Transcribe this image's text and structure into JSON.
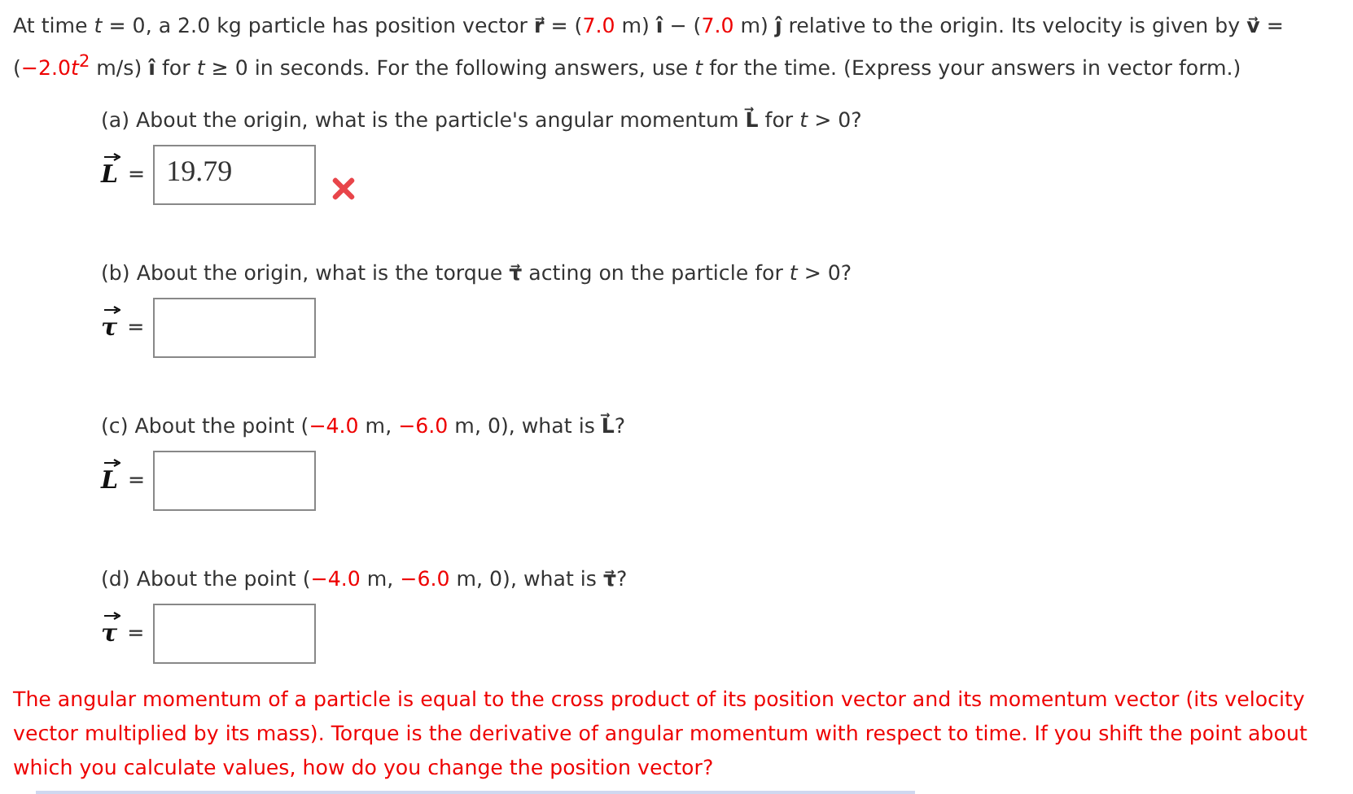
{
  "intro": [
    {
      "text": "At time *t* = 0, a 2.0 kg particle has position vector **r⃗** = (",
      "red": false
    },
    {
      "text": "7.0",
      "red": true
    },
    {
      "text": " m) **î** − (",
      "red": false
    },
    {
      "text": "7.0",
      "red": true
    },
    {
      "text": " m) **ĵ** relative to the origin. Its velocity is given by **v⃗** = (",
      "red": false
    },
    {
      "text": "−2.0",
      "red": true
    },
    {
      "text": "*t*$^{2}$",
      "red": true
    },
    {
      "text": " m/s) **î** for *t* ≥ 0 in seconds. For the following answers, use *t* for the time. (Express your answers in vector form.)",
      "red": false
    }
  ],
  "questions": [
    {
      "prompt": [
        {
          "text": "(a) About the origin, what is the particle's angular momentum **L⃗** for *t* > 0?",
          "red": false
        }
      ],
      "symbol": "L",
      "relation": "=",
      "value": "19.79",
      "incorrect": true
    },
    {
      "prompt": [
        {
          "text": "(b) About the origin, what is the torque **τ⃗** acting on the particle for *t* > 0?",
          "red": false
        }
      ],
      "symbol": "τ",
      "relation": "=",
      "incorrect": false
    },
    {
      "prompt": [
        {
          "text": "(c) About the point (",
          "red": false
        },
        {
          "text": "−4.0",
          "red": true
        },
        {
          "text": " m, ",
          "red": false
        },
        {
          "text": "−6.0",
          "red": true
        },
        {
          "text": " m, 0), what is **L⃗**?",
          "red": false
        }
      ],
      "symbol": "L",
      "relation": "=",
      "incorrect": false
    },
    {
      "prompt": [
        {
          "text": "(d) About the point (",
          "red": false
        },
        {
          "text": "−4.0",
          "red": true
        },
        {
          "text": " m, ",
          "red": false
        },
        {
          "text": "−6.0",
          "red": true
        },
        {
          "text": " m, 0), what is **τ⃗**?",
          "red": false
        }
      ],
      "symbol": "τ",
      "relation": "=",
      "incorrect": false
    }
  ],
  "hint": "The angular momentum of a particle is equal to the cross product of its position vector and its momentum vector (its velocity vector multiplied by its mass). Torque is the derivative of angular momentum with respect to time. If you shift the point about which you calculate values, how do you change the position vector?"
}
